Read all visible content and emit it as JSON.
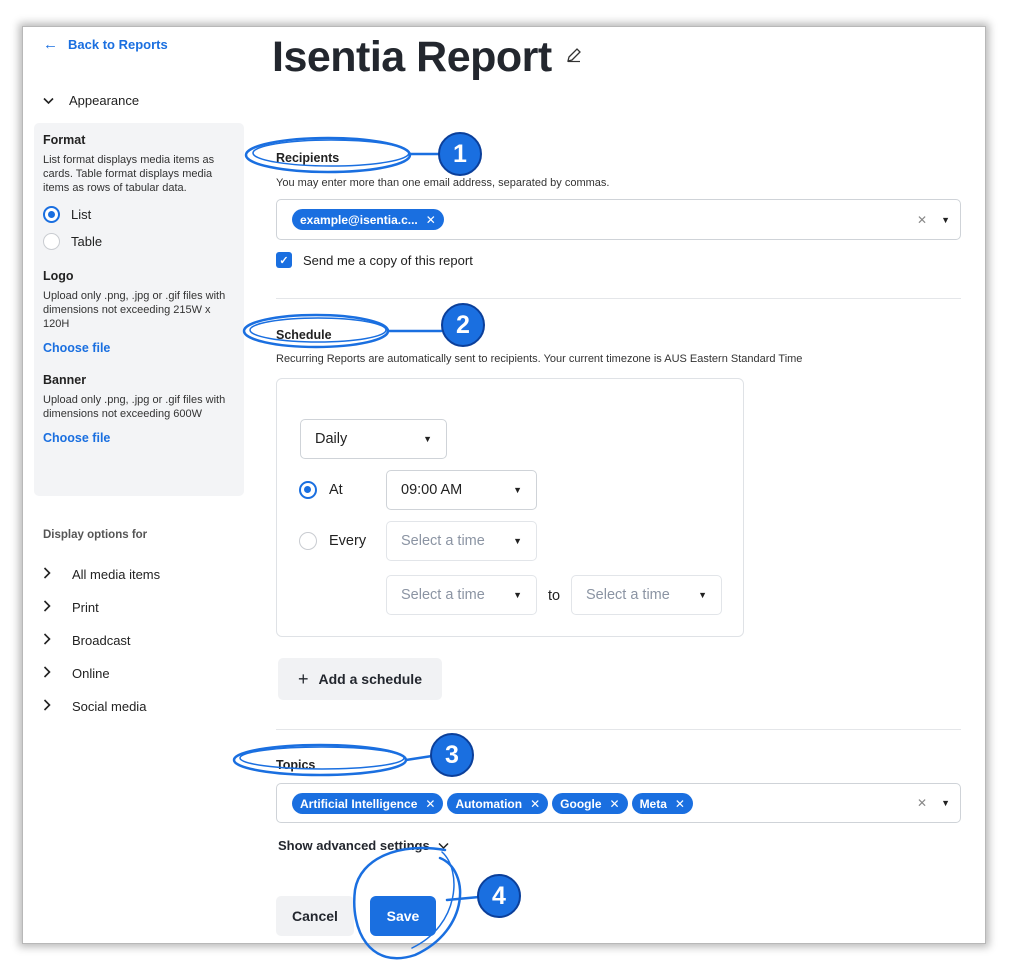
{
  "sidebar": {
    "back_link": "Back to Reports",
    "appearance": "Appearance",
    "format": {
      "heading": "Format",
      "description": "List format displays media items as cards. Table format displays media items as rows of tabular data.",
      "options": [
        "List",
        "Table"
      ],
      "selected": "List"
    },
    "logo": {
      "heading": "Logo",
      "description": "Upload only .png, .jpg or .gif files with dimensions not exceeding 215W x 120H",
      "choose": "Choose file"
    },
    "banner": {
      "heading": "Banner",
      "description": "Upload only .png, .jpg or .gif files with dimensions not exceeding 600W",
      "choose": "Choose file"
    },
    "display_options_label": "Display options for",
    "media_items": [
      "All media items",
      "Print",
      "Broadcast",
      "Online",
      "Social media"
    ]
  },
  "main": {
    "title": "Isentia Report",
    "recipients": {
      "label": "Recipients",
      "description": "You may enter more than one email address, separated by commas.",
      "chips": [
        "example@isentia.c..."
      ],
      "copy_checkbox": "Send me a copy of this report",
      "copy_checked": true
    },
    "schedule": {
      "label": "Schedule",
      "description": "Recurring Reports are automatically sent to recipients. Your current timezone is AUS Eastern Standard Time",
      "frequency": "Daily",
      "at_label": "At",
      "at_time": "09:00 AM",
      "every_label": "Every",
      "every_placeholder": "Select a time",
      "from_placeholder": "Select a time",
      "to_label": "to",
      "to_placeholder": "Select a time",
      "add_schedule": "Add a schedule"
    },
    "topics": {
      "label": "Topics",
      "chips": [
        "Artificial Intelligence",
        "Automation",
        "Google",
        "Meta"
      ]
    },
    "advanced_settings": "Show advanced settings",
    "cancel": "Cancel",
    "save": "Save"
  },
  "annotations": [
    "1",
    "2",
    "3",
    "4"
  ],
  "colors": {
    "accent": "#1a6fe0",
    "badge_border": "#0b3f9a",
    "sidebar_panel": "#f3f4f6",
    "secondary_button": "#f1f2f4"
  },
  "icons": {
    "back": "left-arrow-icon",
    "edit": "pencil-icon",
    "expand": "chevron-icon",
    "remove": "close-icon",
    "dropdown": "caret-down-icon",
    "add": "plus-icon",
    "check": "checkmark-icon"
  }
}
